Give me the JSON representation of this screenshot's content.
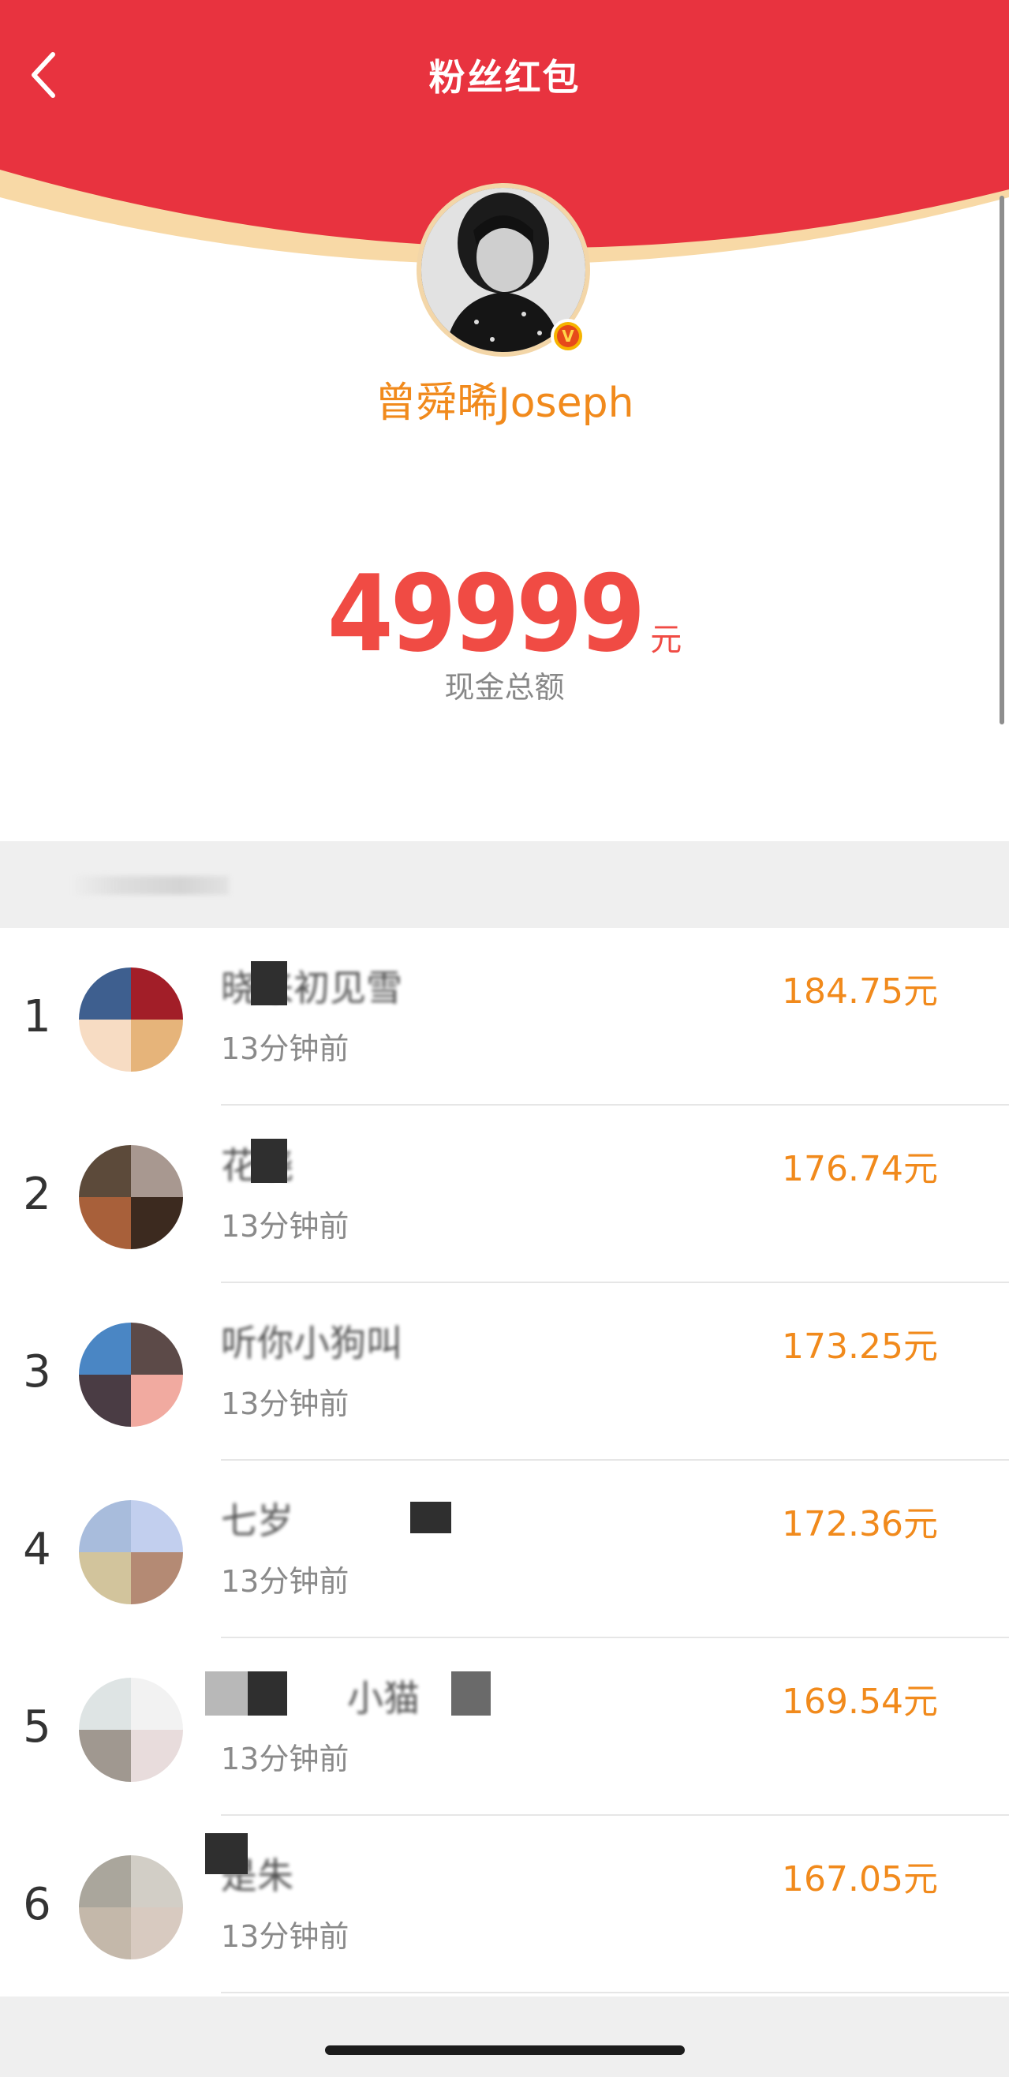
{
  "header": {
    "title": "粉丝红包",
    "back_icon": "chevron-left-icon",
    "background_color": "#e8333f",
    "arc_accent_color": "#f8d9a6"
  },
  "owner": {
    "name": "曾舜晞Joseph",
    "verified_badge": "verified-v-icon"
  },
  "summary": {
    "amount": "49999",
    "unit": "元",
    "label": "现金总额"
  },
  "list": {
    "rows": [
      {
        "rank": "1",
        "name": "晓来初见雪",
        "time": "13分钟前",
        "amount": "184.75元",
        "colors": [
          "#3e5f8f",
          "#a21e28",
          "#f7dcc3",
          "#e6b47a"
        ]
      },
      {
        "rank": "2",
        "name": "花晓",
        "time": "13分钟前",
        "amount": "176.74元",
        "colors": [
          "#5c4a3a",
          "#a89890",
          "#a8603a",
          "#3c2a1f"
        ]
      },
      {
        "rank": "3",
        "name": "听你小狗叫",
        "time": "13分钟前",
        "amount": "173.25元",
        "colors": [
          "#4a86c4",
          "#5c4a48",
          "#4a3c44",
          "#f1aaa0"
        ]
      },
      {
        "rank": "4",
        "name": "七岁",
        "time": "13分钟前",
        "amount": "172.36元",
        "colors": [
          "#a8bcdc",
          "#c2cfee",
          "#d2c49c",
          "#b48a74"
        ]
      },
      {
        "rank": "5",
        "name": "小猫",
        "time": "13分钟前",
        "amount": "169.54元",
        "colors": [
          "#dee4e4",
          "#f2f2f2",
          "#a09890",
          "#e8dcdc"
        ]
      },
      {
        "rank": "6",
        "name": "是朱",
        "time": "13分钟前",
        "amount": "167.05元",
        "colors": [
          "#aaa69c",
          "#d2cec6",
          "#c4b8aa",
          "#d8cac0"
        ]
      }
    ]
  }
}
